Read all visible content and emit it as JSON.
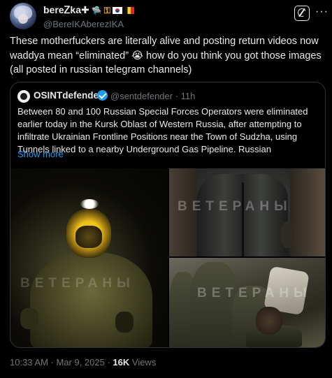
{
  "author": {
    "display_name": "bereᏃka✚",
    "handle": "@BereIKAberezIKA",
    "name_emojis": [
      "ᗢ",
      "🔑",
      "🇰🇷",
      "🇧🇪"
    ]
  },
  "tweet": {
    "text_line1": "These motherfuckers are literally alive and posting return videos now",
    "text_line2": "waddya mean “eliminated” 😭 how do you think you got those images",
    "text_line3": "(all posted in russian telegram channels)"
  },
  "quote": {
    "display_name": "OSINTdefender",
    "handle_time": "@sentdefender · 11h",
    "text": "Between 80 and 100 Russian Special Forces Operators were eliminated earlier today in the Kursk Oblast of Western Russia, after attempting to infiltrate Ukrainian Frontline Positions near the Town of Sudzha, using Tunnels linked to a nearby Underground Gas Pipeline. Russian",
    "show_more": "Show more",
    "watermark": "ВЕТЕРАНЫ"
  },
  "meta": {
    "timestamp": "10:33 AM · Mar 9, 2025 · ",
    "views_count": "16K",
    "views_label": " Views"
  },
  "colors": {
    "background": "#000000",
    "text": "#e7e9ea",
    "secondary": "#71767b",
    "accent": "#1d9bf0",
    "border": "#2f3336"
  },
  "icons": {
    "grok": "grok-icon",
    "more": "more-icon",
    "verified": "verified-badge-icon"
  }
}
